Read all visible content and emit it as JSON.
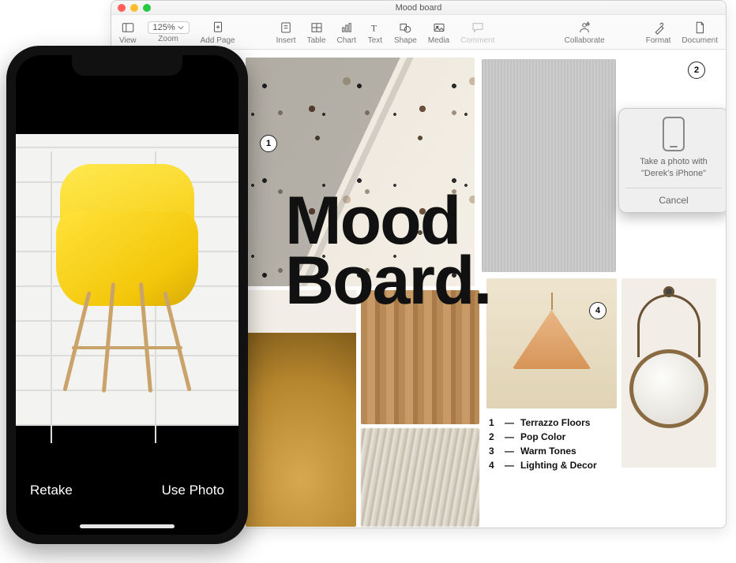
{
  "window": {
    "title": "Mood board",
    "toolbar": {
      "view": "View",
      "zoom_value": "125%",
      "zoom_label": "Zoom",
      "add_page": "Add Page",
      "insert": "Insert",
      "table": "Table",
      "chart": "Chart",
      "text": "Text",
      "shape": "Shape",
      "media": "Media",
      "comment": "Comment",
      "collaborate": "Collaborate",
      "format": "Format",
      "document": "Document"
    }
  },
  "document": {
    "title_line1": "Mood",
    "title_line2": "Board.",
    "callouts": {
      "c1": "1",
      "c2": "2",
      "c4": "4"
    },
    "legend": [
      {
        "num": "1",
        "text": "Terrazzo Floors"
      },
      {
        "num": "2",
        "text": "Pop Color"
      },
      {
        "num": "3",
        "text": "Warm Tones"
      },
      {
        "num": "4",
        "text": "Lighting & Decor"
      }
    ]
  },
  "popover": {
    "message": "Take a photo with \"Derek's iPhone\"",
    "cancel": "Cancel"
  },
  "iphone": {
    "retake": "Retake",
    "use_photo": "Use Photo"
  }
}
